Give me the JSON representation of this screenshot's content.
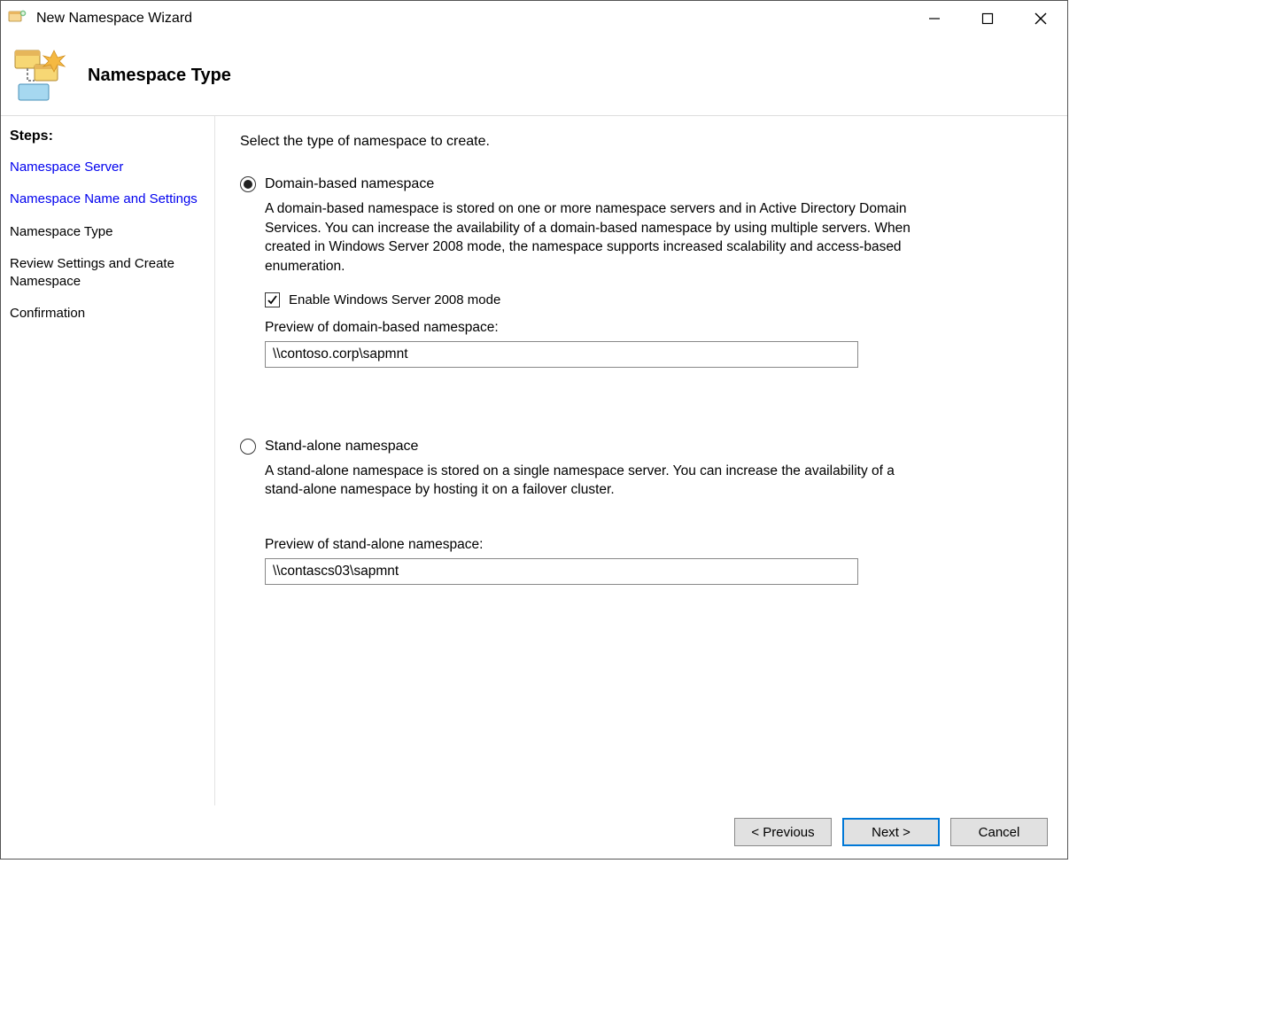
{
  "window": {
    "title": "New Namespace Wizard"
  },
  "banner": {
    "title": "Namespace Type"
  },
  "sidebar": {
    "heading": "Steps:",
    "steps": [
      {
        "label": "Namespace Server",
        "state": "past"
      },
      {
        "label": "Namespace Name and Settings",
        "state": "past"
      },
      {
        "label": "Namespace Type",
        "state": "current"
      },
      {
        "label": "Review Settings and Create Namespace",
        "state": "future"
      },
      {
        "label": "Confirmation",
        "state": "future"
      }
    ]
  },
  "content": {
    "instruction": "Select the type of namespace to create.",
    "option_domain": {
      "label": "Domain-based namespace",
      "selected": true,
      "description": "A domain-based namespace is stored on one or more namespace servers and in Active Directory Domain Services. You can increase the availability of a domain-based namespace by using multiple servers. When created in Windows Server 2008 mode, the namespace supports increased scalability and access-based enumeration.",
      "checkbox_label": "Enable Windows Server 2008 mode",
      "checkbox_checked": true,
      "preview_label": "Preview of domain-based namespace:",
      "preview_value": "\\\\contoso.corp\\sapmnt"
    },
    "option_standalone": {
      "label": "Stand-alone namespace",
      "selected": false,
      "description": "A stand-alone namespace is stored on a single namespace server. You can increase the availability of a stand-alone namespace by hosting it on a failover cluster.",
      "preview_label": "Preview of stand-alone namespace:",
      "preview_value": "\\\\contascs03\\sapmnt"
    }
  },
  "footer": {
    "previous": "< Previous",
    "next": "Next >",
    "cancel": "Cancel"
  }
}
